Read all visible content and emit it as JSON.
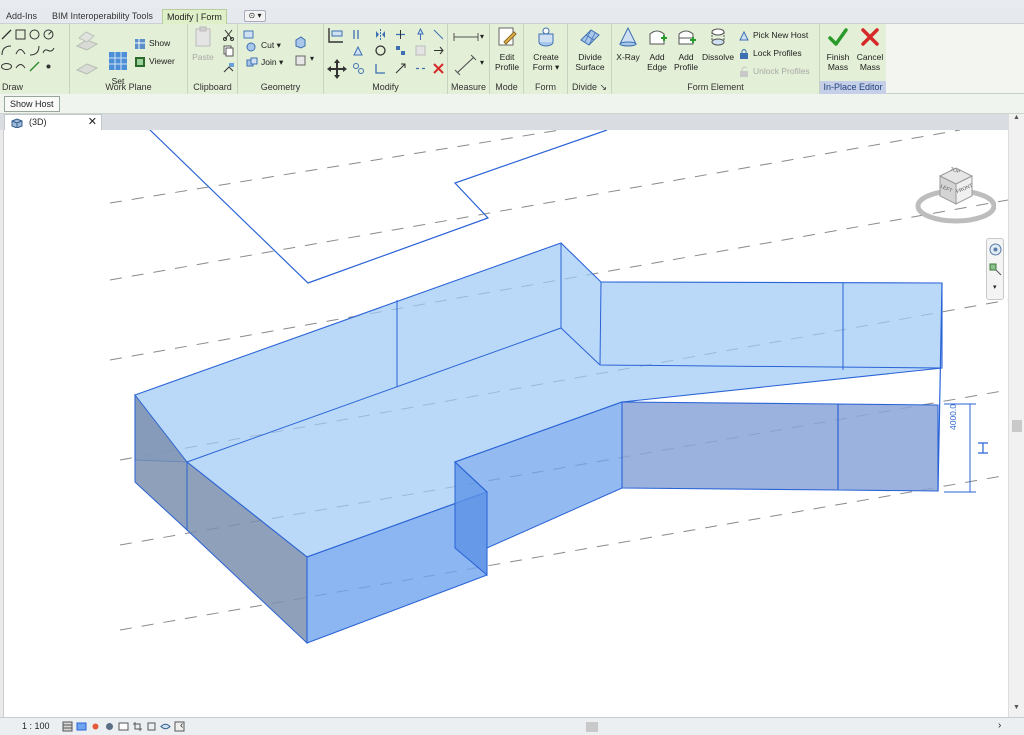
{
  "tabs": [
    {
      "label": "Add-Ins",
      "active": false
    },
    {
      "label": "BIM Interoperability Tools",
      "active": false
    },
    {
      "label": "Modify | Form",
      "active": true
    }
  ],
  "ribbon": {
    "panels": {
      "draw": "Draw",
      "work_plane": "Work Plane",
      "clipboard": "Clipboard",
      "geometry": "Geometry",
      "modify": "Modify",
      "measure": "Measure",
      "mode": "Mode",
      "form": "Form",
      "divide": "Divide",
      "form_element": "Form Element",
      "in_place_editor": "In-Place Editor"
    },
    "work_plane": {
      "set": "Set",
      "show": "Show",
      "viewer": "Viewer"
    },
    "clipboard": {
      "paste": "Paste"
    },
    "geometry": {
      "cut": "Cut",
      "join": "Join"
    },
    "mode": {
      "edit_profile_1": "Edit",
      "edit_profile_2": "Profile"
    },
    "form": {
      "create_form_1": "Create",
      "create_form_2": "Form"
    },
    "divide": {
      "divide_surface_1": "Divide",
      "divide_surface_2": "Surface"
    },
    "form_element": {
      "xray": "X-Ray",
      "add_edge_1": "Add",
      "add_edge_2": "Edge",
      "add_profile_1": "Add",
      "add_profile_2": "Profile",
      "dissolve": "Dissolve",
      "pick_new_host": "Pick  New Host",
      "lock_profiles": "Lock  Profiles",
      "unlock_profiles": "Unlock  Profiles"
    },
    "in_place": {
      "finish_1": "Finish",
      "finish_2": "Mass",
      "cancel_1": "Cancel",
      "cancel_2": "Mass"
    }
  },
  "options_bar": {
    "show_host": "Show Host"
  },
  "view": {
    "tab_label": "(3D)",
    "close": "✕"
  },
  "viewcube": {
    "top": "TOP",
    "front": "FRONT",
    "left": "LEFT"
  },
  "dimension": {
    "value": "4000.0"
  },
  "status": {
    "scale": "1 : 100"
  },
  "colors": {
    "mass_fill": "#9fcbf5",
    "mass_edge": "#2a63d6",
    "shadow_face": "#7b8fae",
    "ribbon_context": "#e3efd6",
    "finish": "#2a9b2a",
    "cancel": "#d62a2a"
  }
}
